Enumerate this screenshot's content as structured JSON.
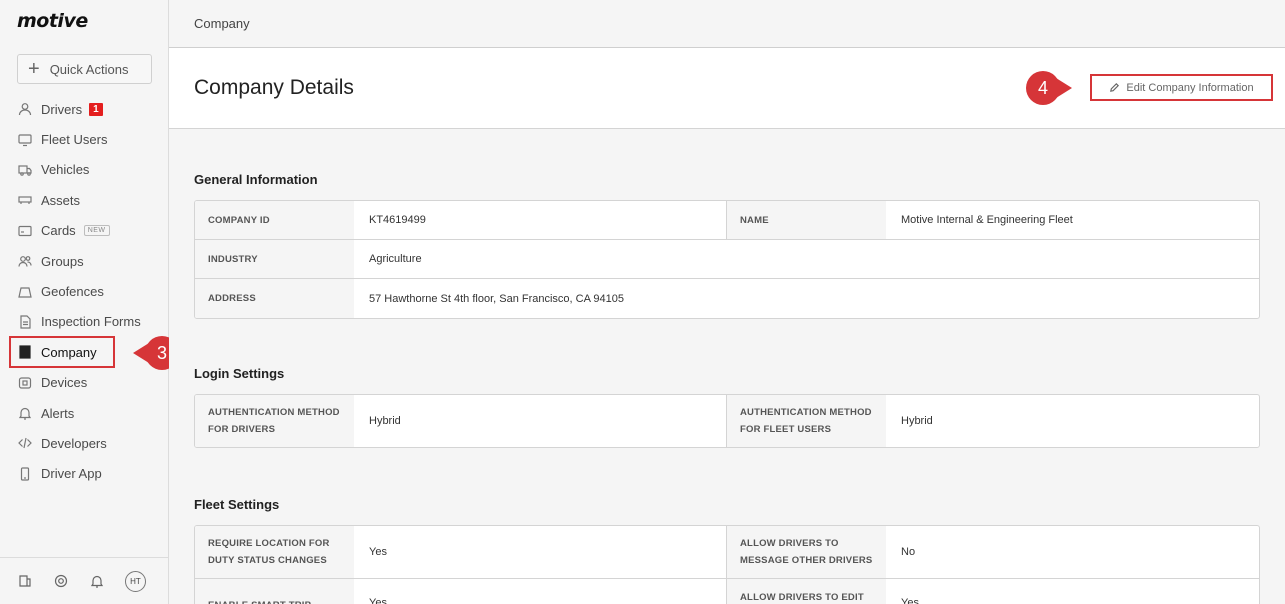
{
  "app": {
    "logo": "motive"
  },
  "sidebar": {
    "quick_actions": "Quick Actions",
    "items": [
      {
        "label": "Drivers",
        "badge": "1"
      },
      {
        "label": "Fleet Users"
      },
      {
        "label": "Vehicles"
      },
      {
        "label": "Assets"
      },
      {
        "label": "Cards",
        "tag": "NEW"
      },
      {
        "label": "Groups"
      },
      {
        "label": "Geofences"
      },
      {
        "label": "Inspection Forms"
      },
      {
        "label": "Company"
      },
      {
        "label": "Devices"
      },
      {
        "label": "Alerts"
      },
      {
        "label": "Developers"
      },
      {
        "label": "Driver App"
      }
    ],
    "avatar": "HT"
  },
  "annotations": {
    "step3": "3",
    "step4": "4",
    "highlight_color": "#d63538"
  },
  "breadcrumb": "Company",
  "header": {
    "title": "Company Details",
    "edit_label": "Edit Company Information"
  },
  "general": {
    "title": "General Information",
    "company_id_label": "COMPANY ID",
    "company_id": "KT4619499",
    "name_label": "NAME",
    "name": "Motive Internal & Engineering Fleet",
    "industry_label": "INDUSTRY",
    "industry": "Agriculture",
    "address_label": "ADDRESS",
    "address": "57 Hawthorne St 4th floor, San Francisco, CA 94105"
  },
  "login": {
    "title": "Login Settings",
    "auth_drivers_label_1": "AUTHENTICATION METHOD",
    "auth_drivers_label_2": "FOR DRIVERS",
    "auth_drivers": "Hybrid",
    "auth_fleet_label_1": "AUTHENTICATION METHOD",
    "auth_fleet_label_2": "FOR FLEET USERS",
    "auth_fleet": "Hybrid"
  },
  "fleet": {
    "title": "Fleet Settings",
    "req_loc_label_1": "REQUIRE LOCATION FOR",
    "req_loc_label_2": "DUTY STATUS CHANGES",
    "req_loc": "Yes",
    "allow_msg_label_1": "ALLOW DRIVERS TO",
    "allow_msg_label_2": "MESSAGE OTHER DRIVERS",
    "allow_msg": "No",
    "smart_trip_label": "ENABLE SMART TRIP MATCH",
    "smart_trip": "Yes",
    "allow_edit_label": "ALLOW DRIVERS TO EDIT",
    "allow_edit": "Yes"
  }
}
